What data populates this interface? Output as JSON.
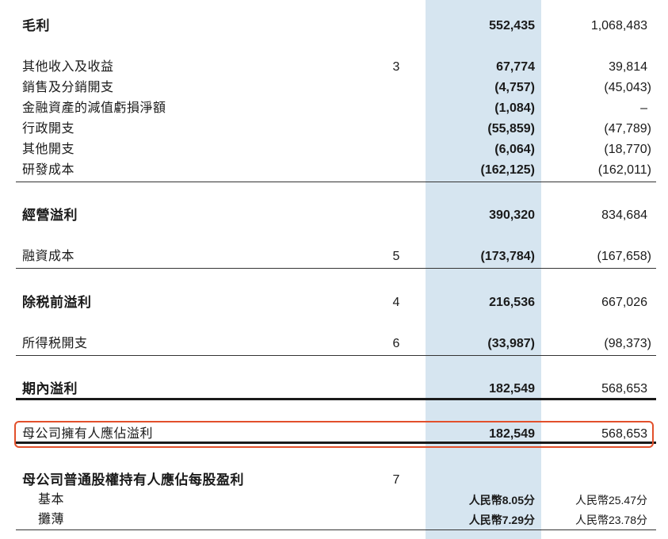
{
  "table": {
    "rows": [
      {
        "label": "毛利",
        "note": "",
        "current": "552,435",
        "prior": "1,068,483",
        "style": "bold"
      },
      {
        "label": "其他收入及收益",
        "note": "3",
        "current": "67,774",
        "prior": "39,814",
        "style": "normal"
      },
      {
        "label": "銷售及分銷開支",
        "note": "",
        "current": "(4,757)",
        "prior": "(45,043)",
        "style": "normal"
      },
      {
        "label": "金融資產的減值虧損淨額",
        "note": "",
        "current": "(1,084)",
        "prior": "–",
        "style": "normal"
      },
      {
        "label": "行政開支",
        "note": "",
        "current": "(55,859)",
        "prior": "(47,789)",
        "style": "normal"
      },
      {
        "label": "其他開支",
        "note": "",
        "current": "(6,064)",
        "prior": "(18,770)",
        "style": "normal"
      },
      {
        "label": "研發成本",
        "note": "",
        "current": "(162,125)",
        "prior": "(162,011)",
        "style": "normal"
      },
      {
        "label": "經營溢利",
        "note": "",
        "current": "390,320",
        "prior": "834,684",
        "style": "bold"
      },
      {
        "label": "融資成本",
        "note": "5",
        "current": "(173,784)",
        "prior": "(167,658)",
        "style": "normal"
      },
      {
        "label": "除税前溢利",
        "note": "4",
        "current": "216,536",
        "prior": "667,026",
        "style": "bold"
      },
      {
        "label": "所得税開支",
        "note": "6",
        "current": "(33,987)",
        "prior": "(98,373)",
        "style": "normal"
      },
      {
        "label": "期內溢利",
        "note": "",
        "current": "182,549",
        "prior": "568,653",
        "style": "bold"
      },
      {
        "label": "母公司擁有人應佔溢利",
        "note": "",
        "current": "182,549",
        "prior": "568,653",
        "style": "normal"
      },
      {
        "label": "母公司普通股權持有人應佔每股盈利",
        "note": "7",
        "current": "",
        "prior": "",
        "style": "bold"
      },
      {
        "label": "基本",
        "note": "",
        "current": "人民幣8.05分",
        "prior": "人民幣25.47分",
        "style": "sub"
      },
      {
        "label": "攤薄",
        "note": "",
        "current": "人民幣7.29分",
        "prior": "人民幣23.78分",
        "style": "sub"
      }
    ]
  },
  "colors": {
    "highlight_column": "#d6e5f0",
    "annotation_box": "#e2502b"
  }
}
